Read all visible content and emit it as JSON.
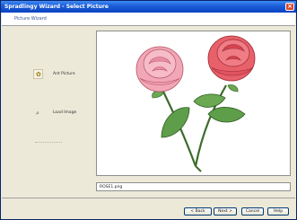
{
  "window": {
    "title": "Spradlingy Wizard - Select Picture"
  },
  "header": {
    "subtitle": "Picture Wizard"
  },
  "options": [
    {
      "label": "Ant Picture"
    },
    {
      "label": "Load Image"
    }
  ],
  "image": {
    "description_icon": "rose-picture"
  },
  "filename": {
    "value": "ROSE1.png"
  },
  "buttons": {
    "back": "< Back",
    "next": "Next >",
    "cancel": "Cancel",
    "help": "Help"
  },
  "colors": {
    "titlebar": "#1e5fd8",
    "window_bg": "#ece9d8",
    "rose_pink": "#f2a7b6",
    "rose_red": "#e8606a",
    "leaf_green": "#5a9a48"
  }
}
